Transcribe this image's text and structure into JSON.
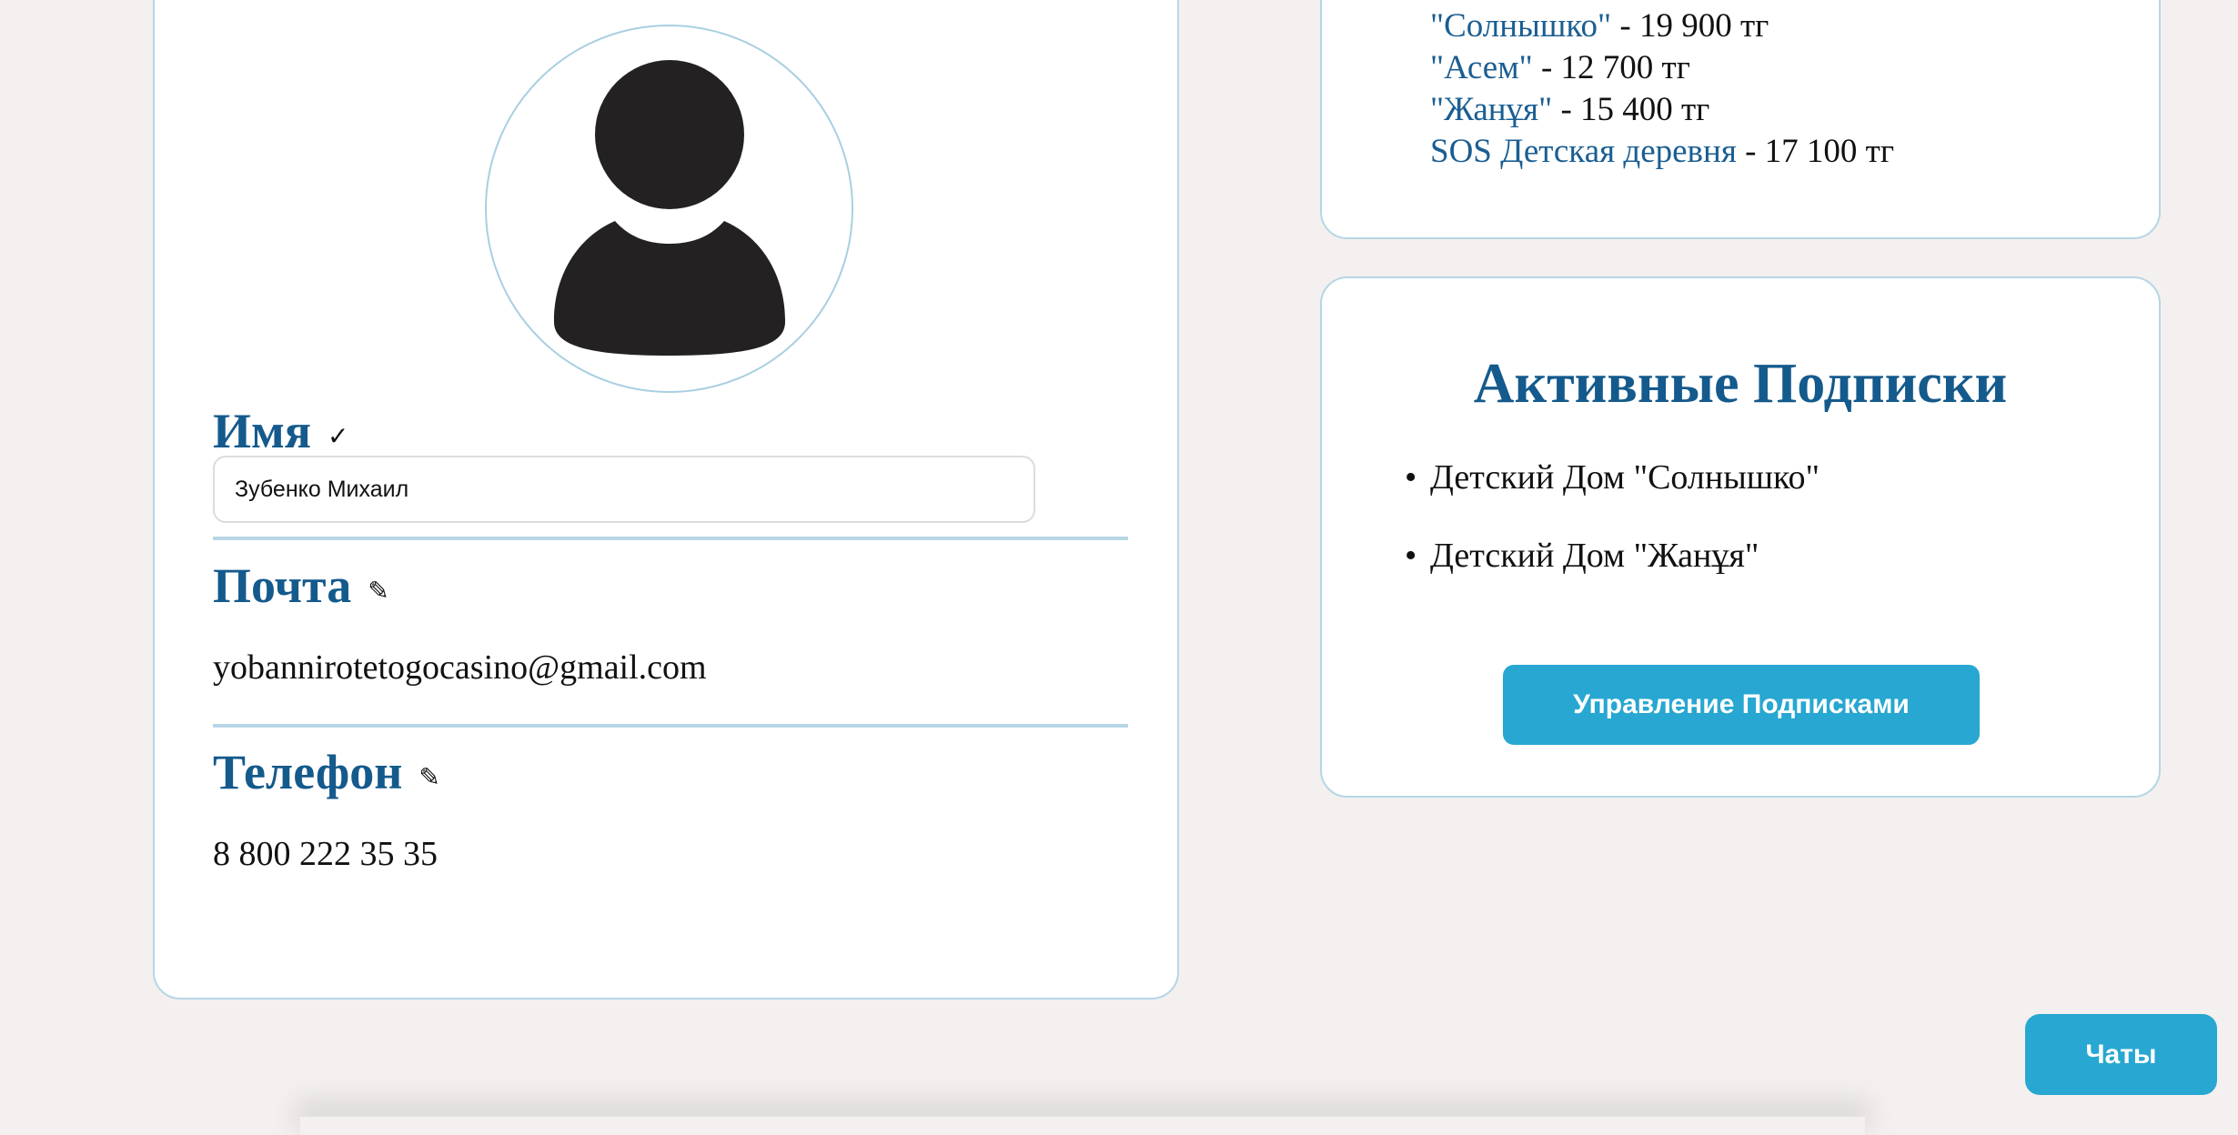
{
  "profile": {
    "name_label": "Имя",
    "name_icon": "✓",
    "name_value": "Зубенко Михаил",
    "email_label": "Почта",
    "email_icon": "✎",
    "email_value": "yobannirotetogocasino@gmail.com",
    "phone_label": "Телефон",
    "phone_icon": "✎",
    "phone_value": "8 800 222 35 35"
  },
  "prices": {
    "items": [
      {
        "name": "\"Солнышко\"",
        "amount": " - 19 900 тг"
      },
      {
        "name": "\"Асем\"",
        "amount": " - 12 700 тг"
      },
      {
        "name": "\"Жанұя\"",
        "amount": " - 15 400 тг"
      },
      {
        "name": "SOS Детская деревня",
        "amount": " - 17 100 тг"
      }
    ]
  },
  "subscriptions": {
    "title": "Активные Подписки",
    "items": [
      "Детский Дом \"Солнышко\"",
      "Детский Дом \"Жанұя\""
    ],
    "manage_label": "Управление Подписками"
  },
  "chats_label": "Чаты",
  "colors": {
    "background": "#f3f0ef",
    "accent": "#145a8c",
    "button": "#27a7d1",
    "border": "#b6d6e6"
  },
  "icons": {
    "avatar": "user-avatar-icon",
    "name_status": "checkmark-icon",
    "edit": "pencil-icon"
  }
}
